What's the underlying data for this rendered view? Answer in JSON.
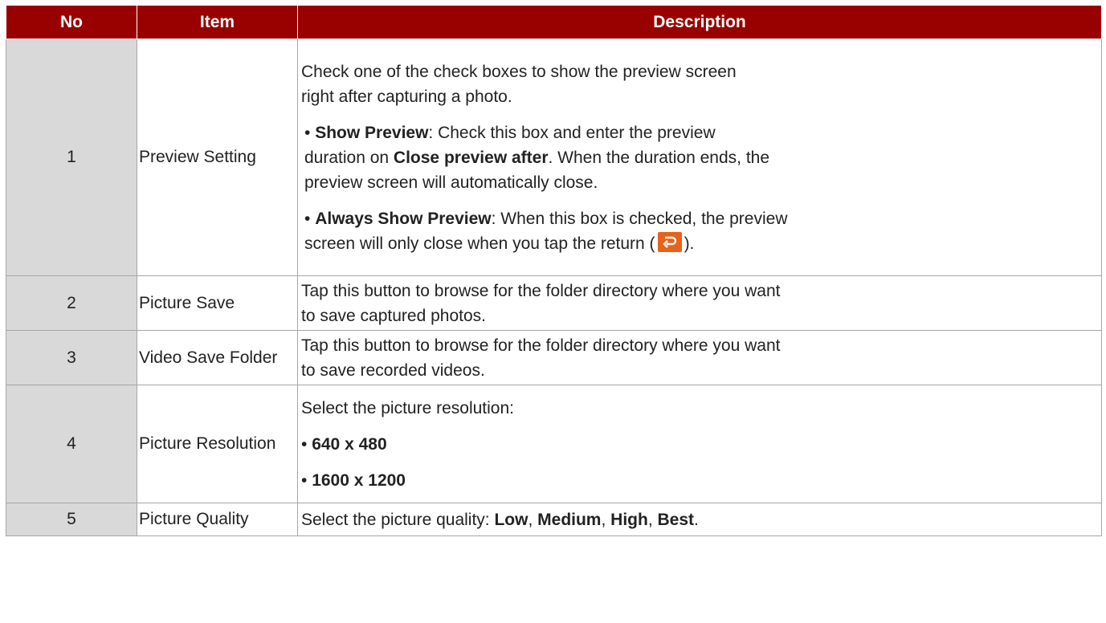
{
  "header": {
    "no": "No",
    "item": "Item",
    "description": "Description"
  },
  "rows": [
    {
      "no": "1",
      "item": "Preview Setting",
      "intro_line1": "Check one of the check boxes to show the preview screen",
      "intro_line2": "right after capturing a photo.",
      "bullet_char": "•",
      "show_preview": {
        "term": "Show Preview",
        "text_a": ": Check this box and enter the preview",
        "text_b": "duration on ",
        "term2": "Close preview after",
        "text_c": ". When the duration ends, the",
        "text_d": "preview screen will automatically close."
      },
      "always_show": {
        "term": "Always Show Preview",
        "text_a": ": When this box is checked, the preview",
        "text_b": "screen will only close when you tap the return (",
        "text_c": ")."
      },
      "return_icon": "return-icon"
    },
    {
      "no": "2",
      "item": "Picture Save",
      "line1": "Tap this button to browse for the folder directory where you want",
      "line2": "to save captured photos."
    },
    {
      "no": "3",
      "item": "Video Save Folder",
      "line1": "Tap this button to browse for the folder directory where you want",
      "line2": "to save recorded videos."
    },
    {
      "no": "4",
      "item": "Picture Resolution",
      "intro": "Select the picture resolution:",
      "options": [
        "640 x 480",
        "1600 x 1200"
      ]
    },
    {
      "no": "5",
      "item": "Picture Quality",
      "intro": "Select the picture quality: ",
      "options": [
        "Low",
        "Medium",
        "High",
        "Best"
      ],
      "sep": ", ",
      "end": "."
    }
  ],
  "colors": {
    "header_bg": "#990000",
    "no_col_bg": "#d9d9d9",
    "icon": "#e8621a"
  }
}
